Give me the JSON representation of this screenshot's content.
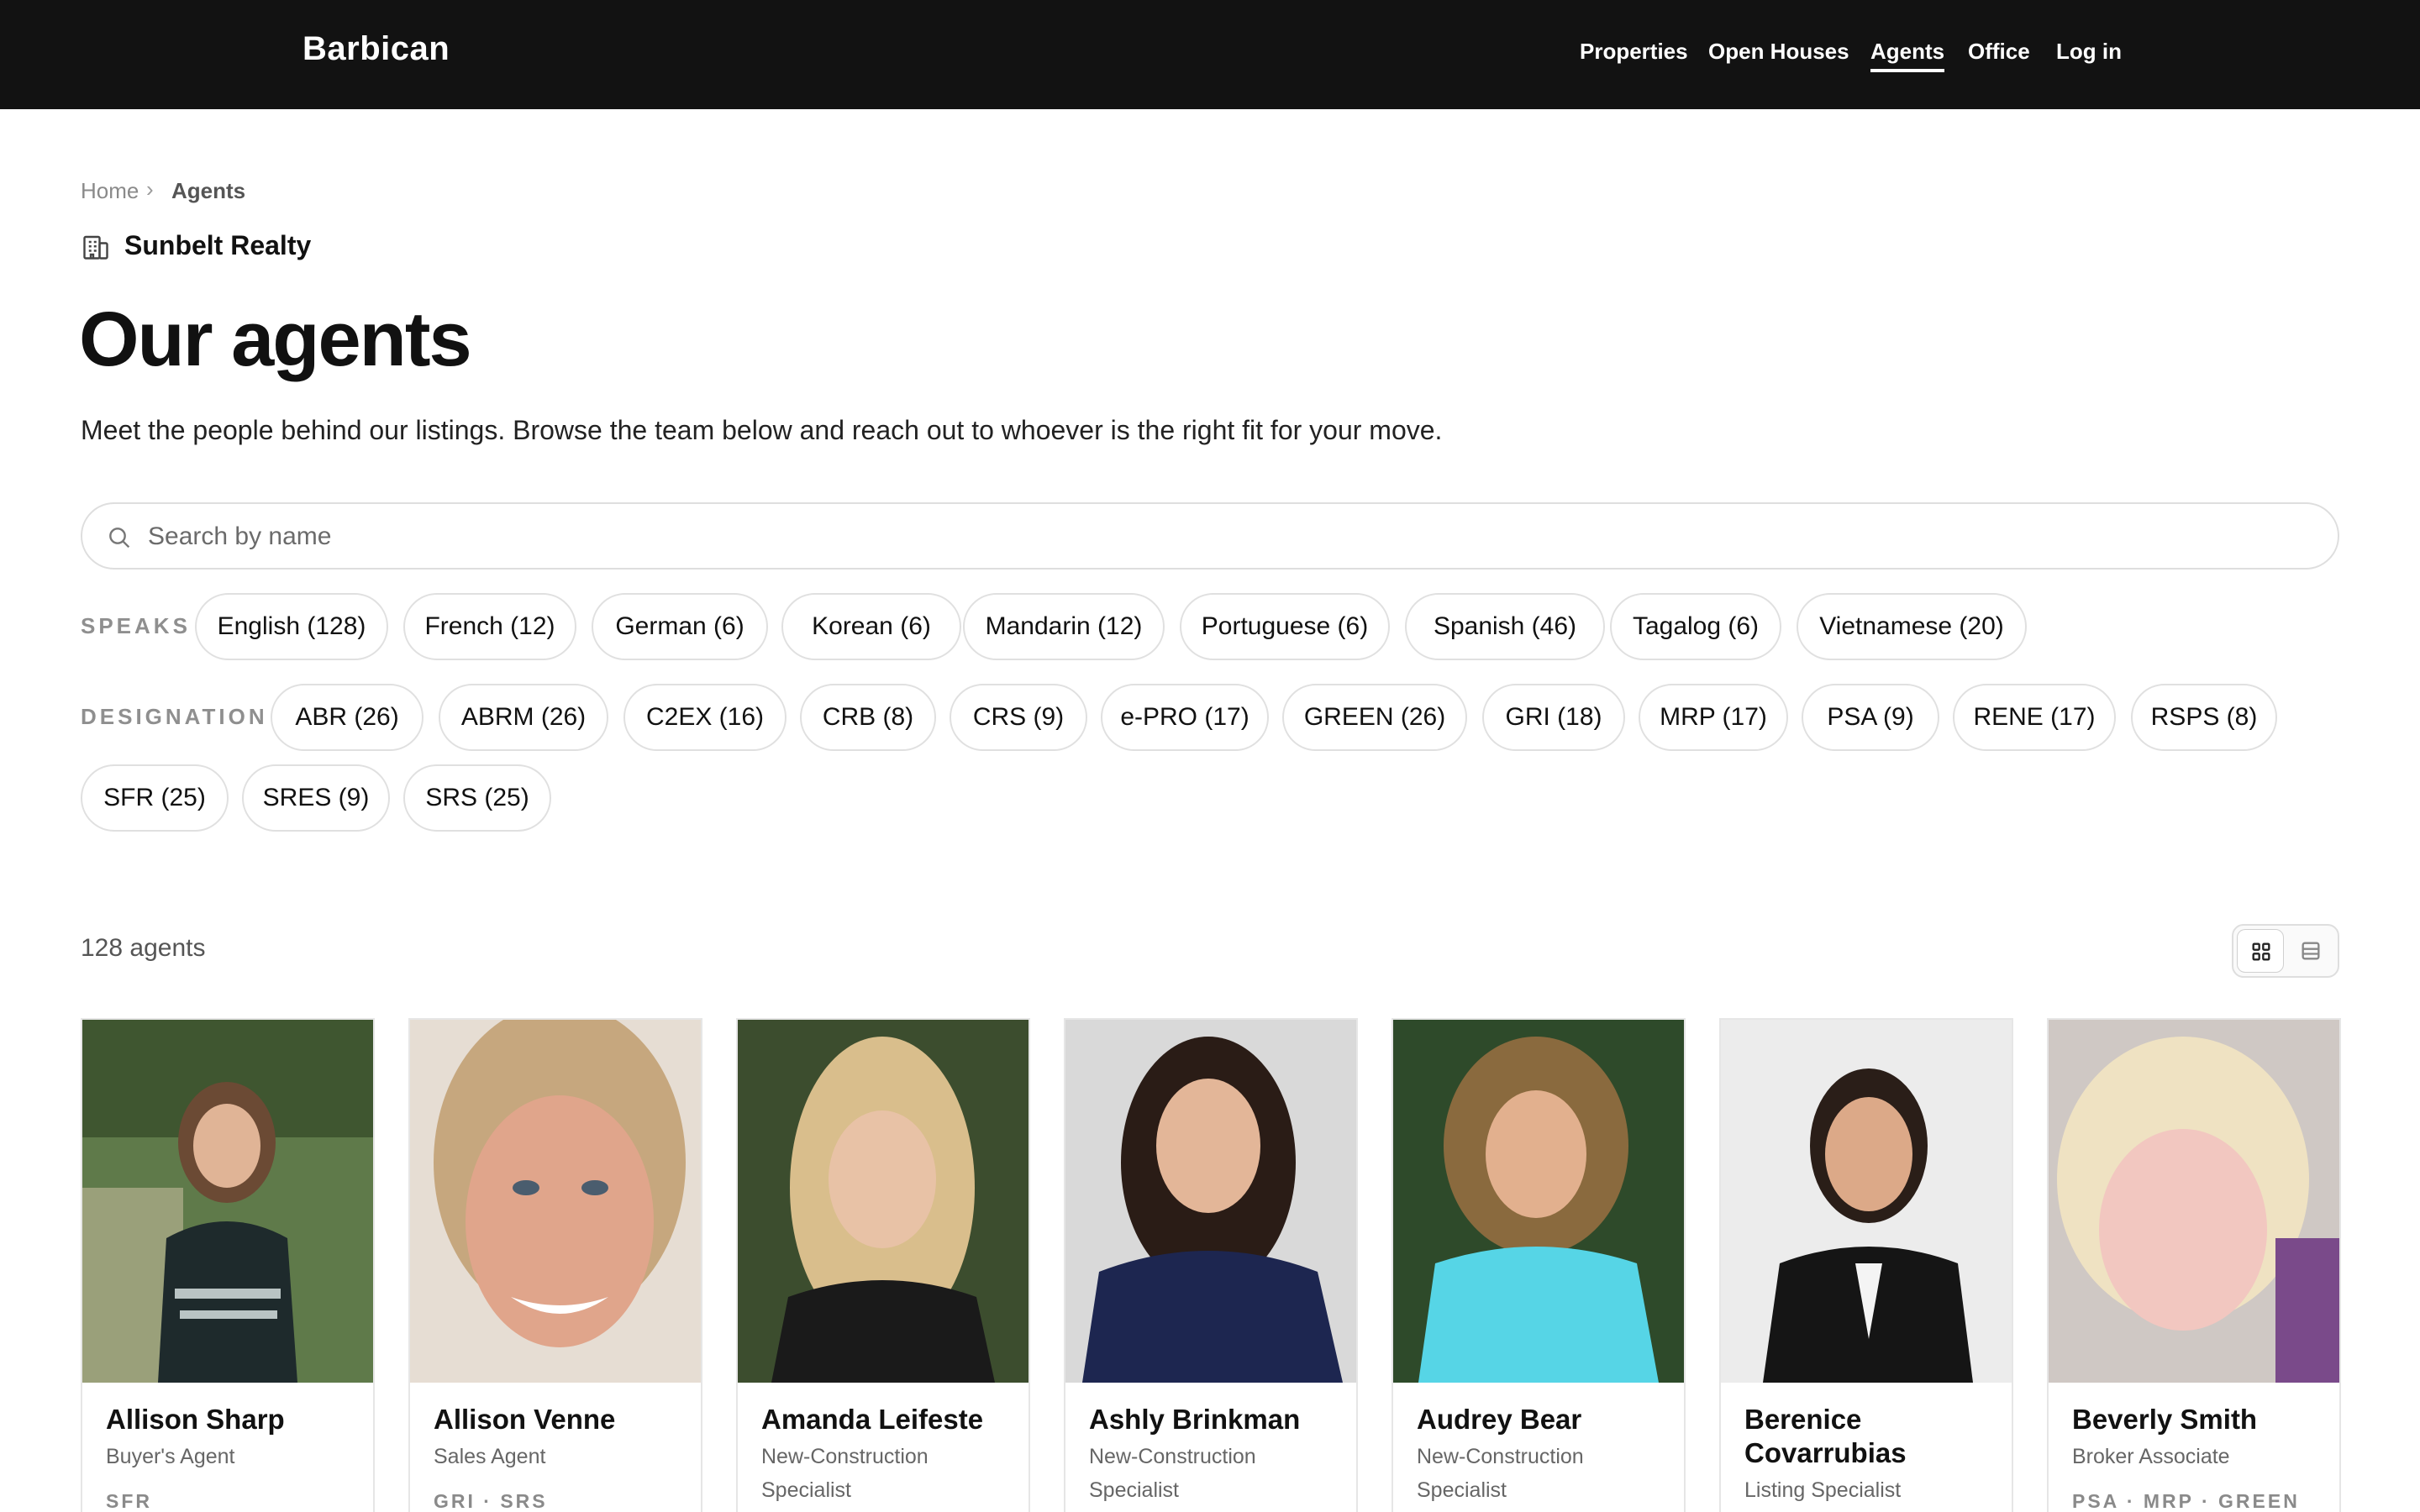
{
  "header": {
    "brand": "Barbican",
    "nav": [
      "Properties",
      "Open Houses",
      "Agents",
      "Office",
      "Log in"
    ],
    "active_nav": "Agents"
  },
  "breadcrumb": {
    "home": "Home",
    "separator": "›",
    "current": "Agents"
  },
  "office": {
    "name": "Sunbelt Realty",
    "icon": "building-icon"
  },
  "title": "Our agents",
  "subtitle": "Meet the people behind our listings. Browse the team below and reach out to whoever is the right fit for your move.",
  "search": {
    "placeholder": "Search by name",
    "value": "",
    "icon": "search-icon"
  },
  "filters": {
    "speaks_label": "SPEAKS",
    "speaks": [
      "English (128)",
      "French (12)",
      "German (6)",
      "Korean (6)",
      "Mandarin (12)",
      "Portuguese (6)",
      "Spanish (46)",
      "Tagalog (6)",
      "Vietnamese (20)"
    ],
    "designation_label": "DESIGNATION",
    "designation": [
      "ABR (26)",
      "ABRM (26)",
      "C2EX (16)",
      "CRB (8)",
      "CRS (9)",
      "e-PRO (17)",
      "GREEN (26)",
      "GRI (18)",
      "MRP (17)",
      "PSA (9)",
      "RENE (17)",
      "RSPS (8)",
      "SFR (25)",
      "SRES (9)",
      "SRS (25)"
    ]
  },
  "results": {
    "count_label": "128 agents",
    "view_icons": [
      "grid-view-icon",
      "list-view-icon"
    ],
    "active_view": "grid"
  },
  "agents": [
    {
      "name": "Allison Sharp",
      "role": "Buyer's Agent",
      "tags": "SFR"
    },
    {
      "name": "Allison Venne",
      "role": "Sales Agent",
      "tags": "GRI · SRS"
    },
    {
      "name": "Amanda Leifeste",
      "role": "New-Construction Specialist",
      "tags": ""
    },
    {
      "name": "Ashly Brinkman",
      "role": "New-Construction Specialist",
      "tags": ""
    },
    {
      "name": "Audrey Bear",
      "role": "New-Construction Specialist",
      "tags": ""
    },
    {
      "name": "Berenice Covarrubias",
      "role": "Listing Specialist",
      "tags": ""
    },
    {
      "name": "Beverly Smith",
      "role": "Broker Associate",
      "tags": "PSA · MRP · GREEN"
    }
  ],
  "colors": {
    "header_bg": "#121212",
    "text": "#111111",
    "muted": "#8f8f8f",
    "chip_border": "#e0e0e0"
  }
}
